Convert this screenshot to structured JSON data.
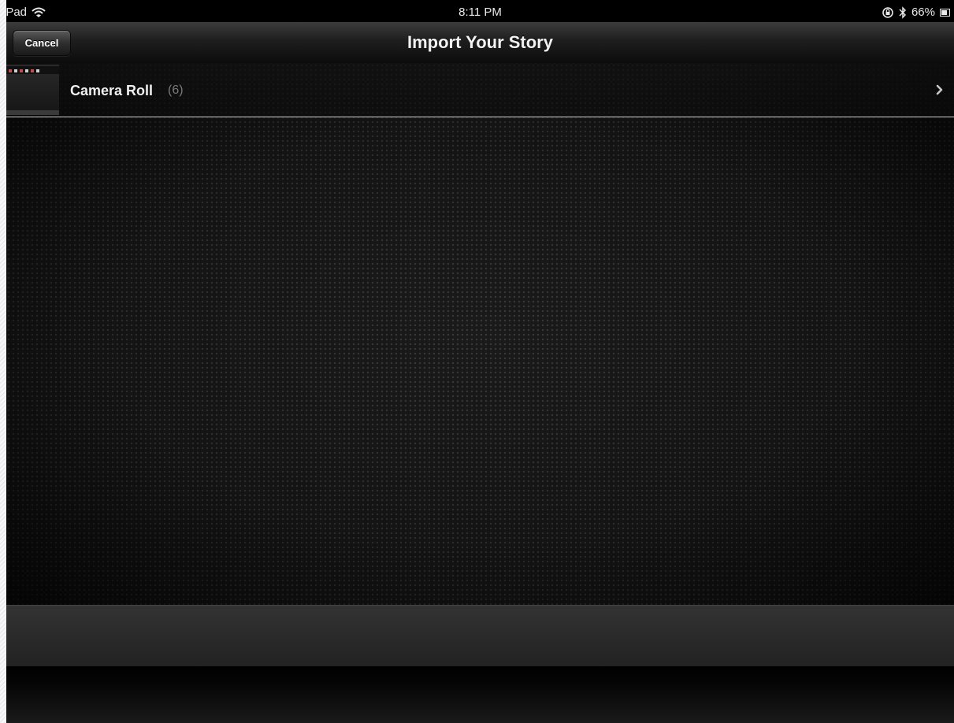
{
  "status_bar": {
    "device": "iPad",
    "time": "8:11 PM",
    "battery": "66%",
    "icons": [
      "wifi-icon",
      "rotation-lock-icon",
      "bluetooth-icon",
      "battery-icon"
    ]
  },
  "nav_bar": {
    "cancel_label": "Cancel",
    "title": "Import Your Story"
  },
  "albums": [
    {
      "name": "Camera Roll",
      "count": "(6)",
      "icon": "chevron-right-icon"
    }
  ],
  "colors": {
    "background": "#000000",
    "text_primary": "#f0f0f0",
    "text_secondary": "#7a7a7a",
    "row_divider": "#cfcfcf"
  }
}
